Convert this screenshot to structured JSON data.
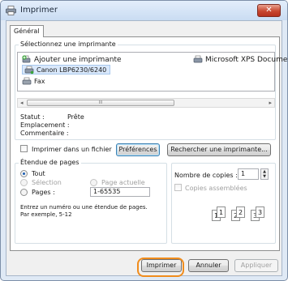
{
  "window": {
    "title": "Imprimer",
    "close_label": "✕"
  },
  "tabs": [
    {
      "label": "Général"
    }
  ],
  "select_printer": {
    "group_label": "Sélectionnez une imprimante",
    "items": [
      {
        "label": "Ajouter une imprimante",
        "icon": "add-printer-icon"
      },
      {
        "label": "Microsoft XPS Document W",
        "icon": "printer-icon"
      },
      {
        "label": "Canon LBP6230/6240",
        "icon": "printer-icon",
        "selected": true
      },
      {
        "label": "Fax",
        "icon": "fax-icon"
      }
    ],
    "scrollbar_grip": "III"
  },
  "status": {
    "status_label": "Statut :",
    "status_value": "Prête",
    "location_label": "Emplacement :",
    "comment_label": "Commentaire :"
  },
  "print_to_file": {
    "label": "Imprimer dans un fichier",
    "checked": false
  },
  "buttons": {
    "preferences": "Préférences",
    "find_printer": "Rechercher une imprimante...",
    "print": "Imprimer",
    "cancel": "Annuler",
    "apply": "Appliquer"
  },
  "page_range": {
    "group_label": "Étendue de pages",
    "all": "Tout",
    "selection": "Sélection",
    "current_page": "Page actuelle",
    "pages": "Pages :",
    "pages_value": "1-65535",
    "hint_line1": "Entrez un numéro ou une étendue de pages.",
    "hint_line2": "Par exemple, 5-12",
    "selected_option": "Tout"
  },
  "copies": {
    "label": "Nombre de copies :",
    "value": "1",
    "collate_label": "Copies assemblées",
    "collate_checked": false,
    "collate_pages": [
      "1",
      "1",
      "2",
      "2",
      "3",
      "3"
    ]
  },
  "accent_color": "#f08c1c"
}
